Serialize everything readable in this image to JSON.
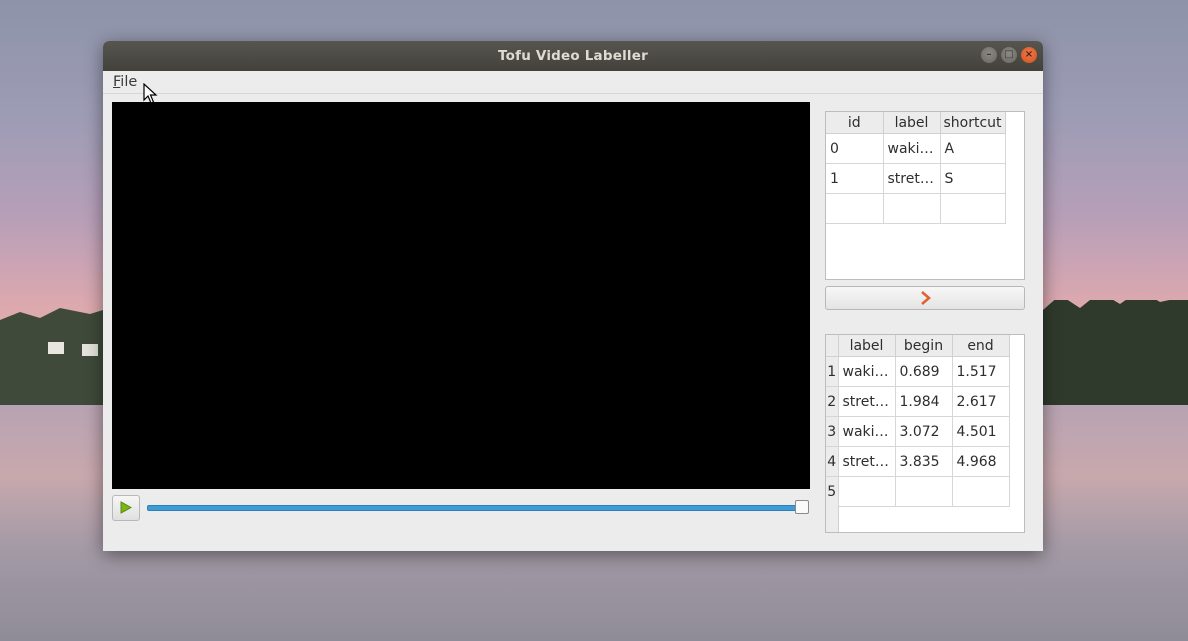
{
  "window": {
    "title": "Tofu Video Labeller"
  },
  "menu": {
    "file_prefix": "F",
    "file_rest": "ile"
  },
  "labels_table": {
    "headers": [
      "id",
      "label",
      "shortcut"
    ],
    "rows": [
      [
        "0",
        "waki…",
        "A"
      ],
      [
        "1",
        "stret…",
        "S"
      ],
      [
        "",
        "",
        ""
      ]
    ]
  },
  "segments_table": {
    "headers": [
      "",
      "label",
      "begin",
      "end"
    ],
    "rows": [
      [
        "1",
        "waki…",
        "0.689",
        "1.517"
      ],
      [
        "2",
        "stret…",
        "1.984",
        "2.617"
      ],
      [
        "3",
        "waki…",
        "3.072",
        "4.501"
      ],
      [
        "4",
        "stret…",
        "3.835",
        "4.968"
      ],
      [
        "5",
        "",
        "",
        ""
      ]
    ]
  },
  "player": {
    "progress": 1.0
  },
  "icons": {
    "play": "play-icon",
    "transfer": "chevron-right-icon",
    "close": "close-icon",
    "minimize": "minimize-icon",
    "maximize": "maximize-icon"
  },
  "colors": {
    "accent": "#3d9bd8",
    "play": "#7cb518",
    "close": "#e0602d",
    "chevron": "#e0602d"
  }
}
